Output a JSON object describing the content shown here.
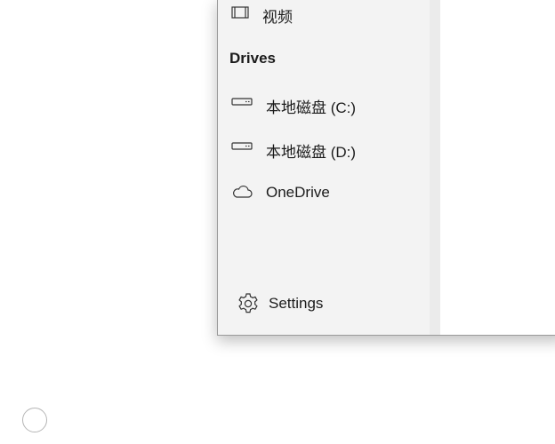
{
  "nav": {
    "videos_label": "视频",
    "drives_header": "Drives",
    "drive_c_label": "本地磁盘 (C:)",
    "drive_d_label": "本地磁盘 (D:)",
    "onedrive_label": "OneDrive",
    "settings_label": "Settings"
  },
  "icons": {
    "videos": "film-icon",
    "drive_c": "hard-drive-icon",
    "drive_d": "hard-drive-icon",
    "onedrive": "cloud-icon",
    "settings": "gear-icon"
  }
}
